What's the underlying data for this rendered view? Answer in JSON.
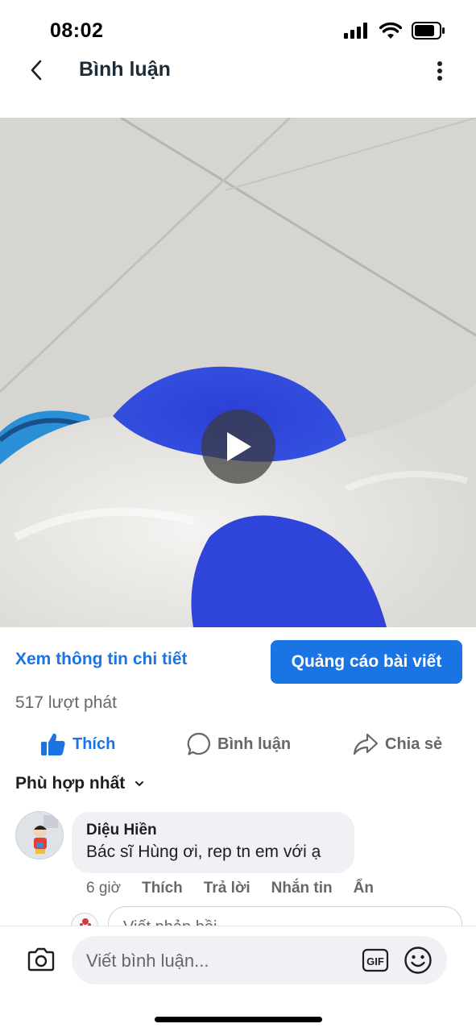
{
  "status_bar": {
    "time": "08:02"
  },
  "header": {
    "title": "Bình luận",
    "back_icon": "chevron-left-icon",
    "more_icon": "more-vertical-icon"
  },
  "video": {
    "play_icon": "play-icon"
  },
  "post_actions": {
    "details_link": "Xem thông tin chi tiết",
    "boost_button": "Quảng cáo bài viết",
    "views": "517 lượt phát"
  },
  "reactions": {
    "like": "Thích",
    "comment": "Bình luận",
    "share": "Chia sẻ"
  },
  "sort": {
    "label": "Phù hợp nhất"
  },
  "comments": [
    {
      "author": "Diệu Hiền",
      "text": "Bác sĩ Hùng ơi, rep tn em với ạ",
      "time": "6 giờ",
      "actions": [
        "Thích",
        "Trả lời",
        "Nhắn tin",
        "Ẩn"
      ]
    }
  ],
  "reply": {
    "placeholder": "Viết phản hồi..."
  },
  "composer": {
    "placeholder": "Viết bình luận...",
    "gif_label": "GIF"
  },
  "colors": {
    "accent": "#1b74e4",
    "secondary_text": "#65676b",
    "bubble": "#eff1f4"
  }
}
